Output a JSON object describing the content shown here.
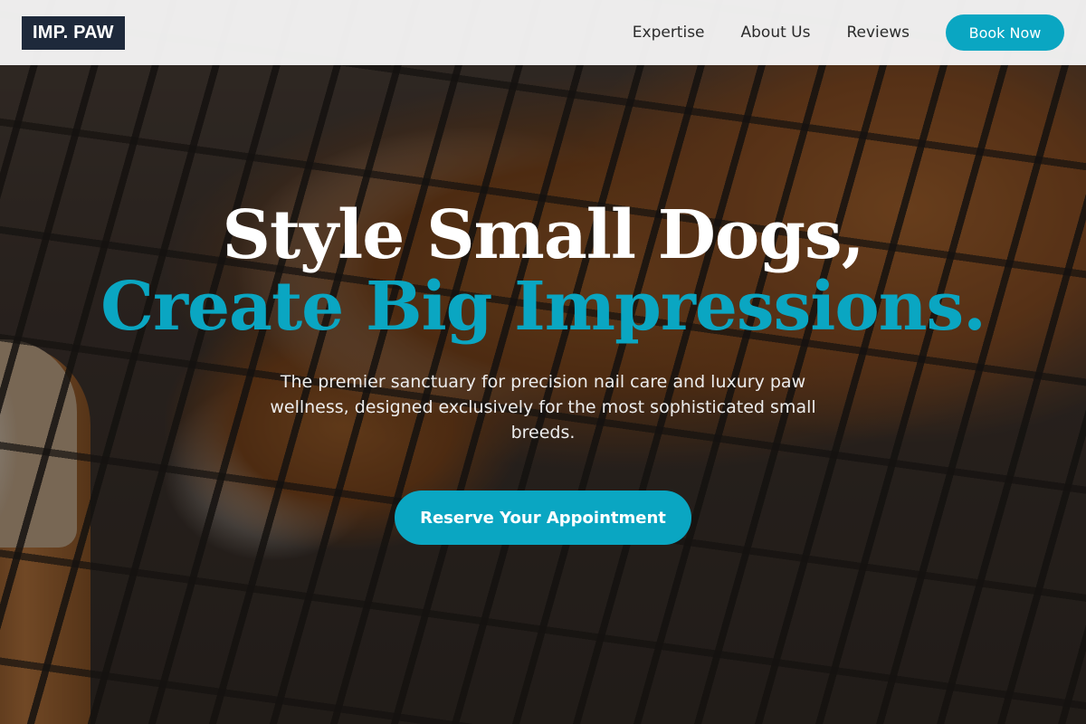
{
  "nav": {
    "logo": "IMP. PAW",
    "links": [
      "Expertise",
      "About Us",
      "Reviews"
    ],
    "book_label": "Book Now"
  },
  "hero": {
    "headline_line1": "Style Small Dogs,",
    "headline_line2": "Create Big Impressions.",
    "subtitle": "The premier sanctuary for precision nail care and luxury paw wellness, designed exclusively for the most sophisticated small breeds.",
    "cta_label": "Reserve Your Appointment"
  },
  "colors": {
    "accent": "#0aa6c2",
    "logo_bg": "#1e293b",
    "nav_bg": "#f5f5f5"
  }
}
